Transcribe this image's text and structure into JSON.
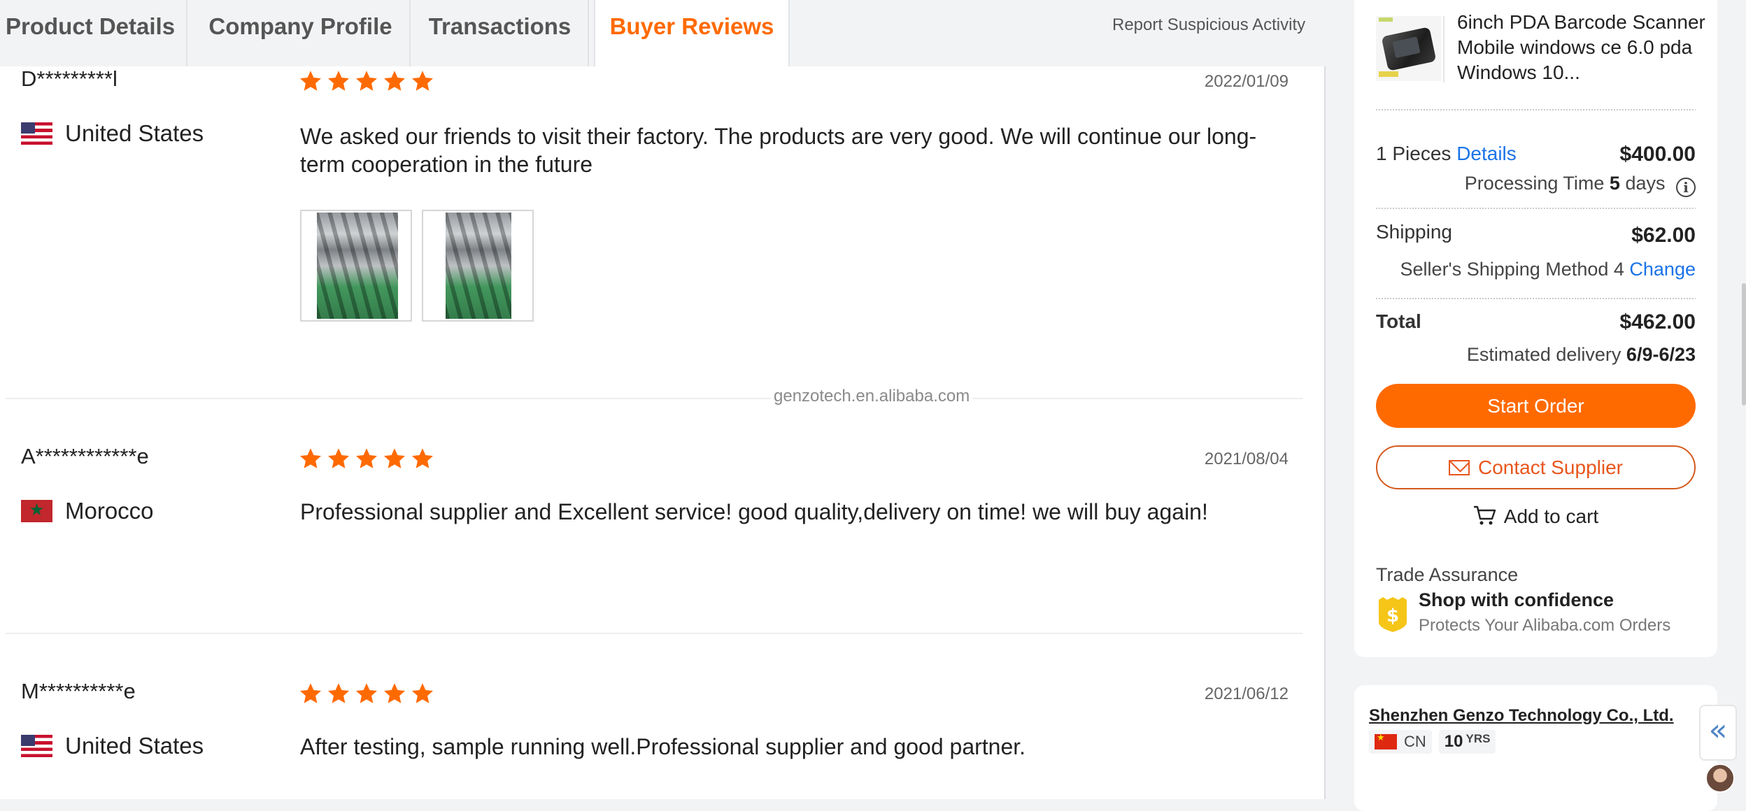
{
  "tabs": [
    {
      "label": "Product Details"
    },
    {
      "label": "Company Profile"
    },
    {
      "label": "Transactions"
    },
    {
      "label": "Buyer Reviews"
    }
  ],
  "report_link": "Report Suspicious Activity",
  "reviews": [
    {
      "reviewer": "D*********l",
      "country": "United States",
      "flag": "us-flag-icon",
      "rating": 5,
      "date": "2022/01/09",
      "text": "We asked our friends to visit their factory. The products are very good. We will continue our long-term cooperation in the future",
      "photos": 2
    },
    {
      "reviewer": "A************e",
      "country": "Morocco",
      "flag": "morocco-flag-icon",
      "rating": 5,
      "date": "2021/08/04",
      "text": "Professional supplier and Excellent service! good quality,delivery on time! we will buy again!"
    },
    {
      "reviewer": "M**********e",
      "country": "United States",
      "flag": "us-flag-icon",
      "rating": 5,
      "date": "2021/06/12",
      "text": "After testing, sample running well.Professional supplier and good partner."
    }
  ],
  "watermark": "genzotech.en.alibaba.com",
  "order": {
    "product_title": "6inch PDA Barcode Scanner Mobile windows ce 6.0 pda Windows 10...",
    "quantity_label": "1 Pieces",
    "details_link": "Details",
    "price": "$400.00",
    "processing_label": "Processing Time",
    "processing_value": "5",
    "processing_unit": "days",
    "shipping_label": "Shipping",
    "shipping_price": "$62.00",
    "shipping_method": "Seller's Shipping Method 4",
    "change_link": "Change",
    "total_label": "Total",
    "total_price": "$462.00",
    "delivery_label": "Estimated delivery",
    "delivery_value": "6/9-6/23",
    "start_order": "Start Order",
    "contact_supplier": "Contact Supplier",
    "add_to_cart": "Add to cart",
    "trade_assurance": "Trade Assurance",
    "shop_confidence": "Shop with confidence",
    "protects": "Protects Your Alibaba.com Orders"
  },
  "supplier": {
    "name": "Shenzhen Genzo Technology Co., Ltd.",
    "country_code": "CN",
    "years": "10",
    "years_unit": "YRS"
  },
  "colors": {
    "accent": "#ff6a00",
    "star": "#ff6a00",
    "link": "#1a73e8",
    "contact": "#e8561c"
  }
}
